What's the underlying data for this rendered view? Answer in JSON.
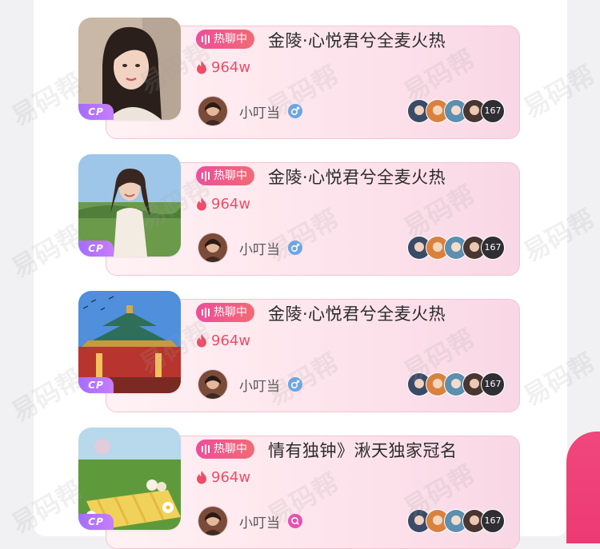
{
  "colors": {
    "tag_gradient_start": "#ee4d9b",
    "tag_gradient_end": "#f26a73",
    "heat_color": "#ee4d67",
    "cp_badge": "#b374ff",
    "male_icon": "#6aa6e6",
    "other_icon": "#e94fb0"
  },
  "watermark_text": "易码帮",
  "rooms": [
    {
      "cover": "portrait-woman-icon",
      "badge": "CP",
      "tag_label": "热聊中",
      "title": "金陵·心悦君兮全麦火热",
      "heat": "964w",
      "host_name": "小叮当",
      "host_gender_icon": "male-icon",
      "member_count": "167"
    },
    {
      "cover": "woman-on-hill-icon",
      "badge": "CP",
      "tag_label": "热聊中",
      "title": "金陵·心悦君兮全麦火热",
      "heat": "964w",
      "host_name": "小叮当",
      "host_gender_icon": "male-icon",
      "member_count": "167"
    },
    {
      "cover": "pavilion-icon",
      "badge": "CP",
      "tag_label": "热聊中",
      "title": "金陵·心悦君兮全麦火热",
      "heat": "964w",
      "host_name": "小叮当",
      "host_gender_icon": "male-icon",
      "member_count": "167"
    },
    {
      "cover": "picnic-icon",
      "badge": "CP",
      "tag_label": "热聊中",
      "title": "情有独钟》湫天独家冠名",
      "heat": "964w",
      "host_name": "小叮当",
      "host_gender_icon": "search-badge-icon",
      "member_count": "167"
    }
  ]
}
